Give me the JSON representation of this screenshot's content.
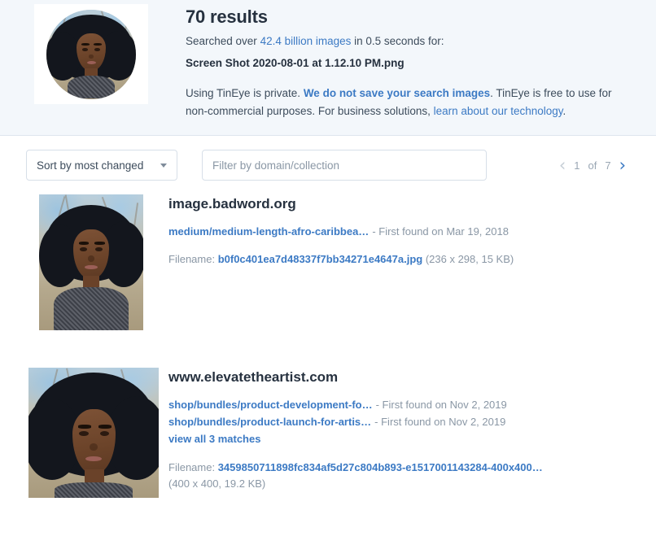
{
  "header": {
    "results_count": "70 results",
    "searched_prefix": "Searched over ",
    "searched_images": "42.4 billion images",
    "searched_suffix": " in 0.5 seconds for:",
    "query_filename": "Screen Shot 2020-08-01 at 1.12.10 PM.png",
    "privacy_prefix": "Using TinEye is private. ",
    "privacy_link1": "We do not save your search images",
    "privacy_middle": ". TinEye is free to use for non-commercial purposes. For business solutions, ",
    "privacy_link2": "learn about our technology",
    "privacy_suffix": ".",
    "query_image_alt": "query-thumbnail"
  },
  "toolbar": {
    "sort_label": "Sort by most changed",
    "filter_placeholder": "Filter by domain/collection",
    "filter_value": "",
    "pager": {
      "prev_icon": "‹",
      "next_icon": "›",
      "current_page": "1",
      "of_label": "of",
      "total_pages": "7"
    }
  },
  "results": [
    {
      "domain": "image.badword.org",
      "thumb_alt": "result-thumbnail-1",
      "matches": [
        {
          "path": "medium/medium-length-afro-caribbea…",
          "found": "- First found on Mar 19, 2018"
        }
      ],
      "view_all": "",
      "filename_label": "Filename: ",
      "filename": "b0f0c401ea7d48337f7bb34271e4647a.jpg",
      "dimensions": " (236 x 298, 15 KB)"
    },
    {
      "domain": "www.elevatetheartist.com",
      "thumb_alt": "result-thumbnail-2",
      "matches": [
        {
          "path": "shop/bundles/product-development-fo…",
          "found": "- First found on Nov 2, 2019"
        },
        {
          "path": "shop/bundles/product-launch-for-artis…",
          "found": "- First found on Nov 2, 2019"
        }
      ],
      "view_all": "view all 3 matches",
      "filename_label": "Filename: ",
      "filename": "3459850711898fc834af5d27c804b893-e1517001143284-400x400…",
      "dimensions": "(400 x 400, 19.2 KB)"
    }
  ],
  "colors": {
    "link": "#3c7ac4",
    "text": "#2d3e50",
    "muted": "#8a97a5",
    "panel_bg": "#f3f7fb",
    "border": "#d7dfe8"
  }
}
